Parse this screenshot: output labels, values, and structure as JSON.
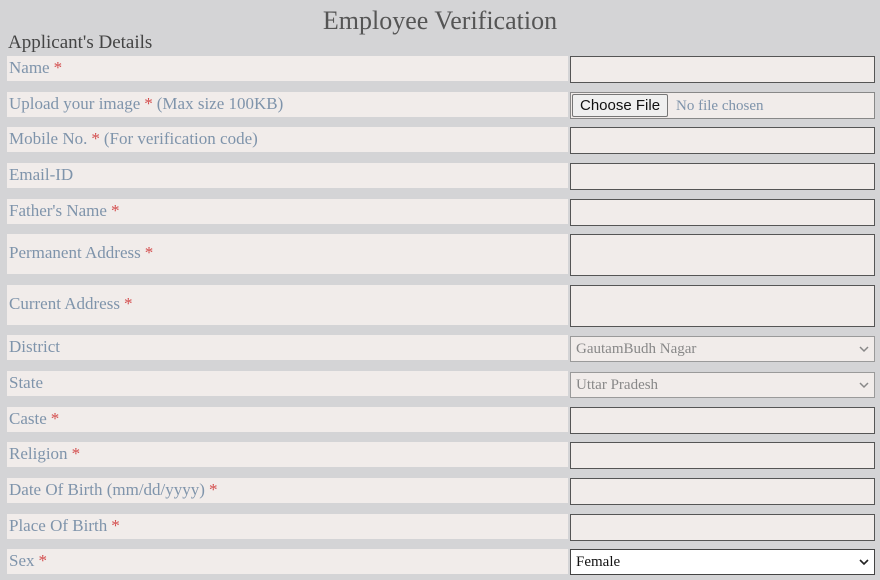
{
  "page": {
    "title": "Employee Verification",
    "section": "Applicant's Details"
  },
  "fields": {
    "name": {
      "label": "Name",
      "required": "*"
    },
    "image": {
      "label": "Upload your image",
      "required": "*",
      "suffix": "(Max size 100KB)",
      "button": "Choose File",
      "status": "No file chosen"
    },
    "mobile": {
      "label": "Mobile No.",
      "required": "*",
      "suffix": "(For verification code)"
    },
    "email": {
      "label": "Email-ID"
    },
    "father": {
      "label": "Father's Name",
      "required": "*"
    },
    "permanent_address": {
      "label": "Permanent Address",
      "required": "*"
    },
    "current_address": {
      "label": "Current Address",
      "required": "*"
    },
    "district": {
      "label": "District",
      "value": "GautamBudh Nagar"
    },
    "state": {
      "label": "State",
      "value": "Uttar Pradesh"
    },
    "caste": {
      "label": "Caste",
      "required": "*"
    },
    "religion": {
      "label": "Religion",
      "required": "*"
    },
    "dob": {
      "label": "Date Of Birth (mm/dd/yyyy)",
      "required": "*"
    },
    "pob": {
      "label": "Place Of Birth",
      "required": "*"
    },
    "sex": {
      "label": "Sex",
      "required": "*",
      "value": "Female"
    }
  },
  "colors": {
    "label": "#7f94ab",
    "required": "#d34a4a",
    "row_bg": "#f1ecea",
    "page_bg": "#d4d4d6"
  }
}
